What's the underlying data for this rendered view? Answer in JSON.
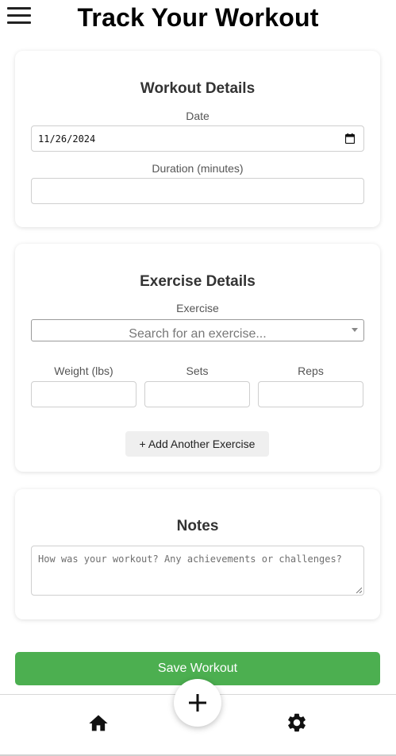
{
  "header": {
    "title": "Track Your Workout",
    "menu_icon": "hamburger-menu-icon"
  },
  "workout_details": {
    "title": "Workout Details",
    "date_label": "Date",
    "date_value": "11/26/2024",
    "duration_label": "Duration (minutes)",
    "duration_value": ""
  },
  "exercise_details": {
    "title": "Exercise Details",
    "exercise_label": "Exercise",
    "exercise_placeholder": "Search for an exercise...",
    "weight_label": "Weight (lbs)",
    "sets_label": "Sets",
    "reps_label": "Reps",
    "add_button": "+ Add Another Exercise"
  },
  "notes": {
    "title": "Notes",
    "placeholder": "How was your workout? Any achievements or challenges?"
  },
  "save_button": "Save Workout",
  "bottom_nav": {
    "home_icon": "home-icon",
    "add_icon": "plus-icon",
    "settings_icon": "gear-icon"
  },
  "colors": {
    "accent": "#4caf50",
    "title": "#000000",
    "text": "#333333"
  }
}
